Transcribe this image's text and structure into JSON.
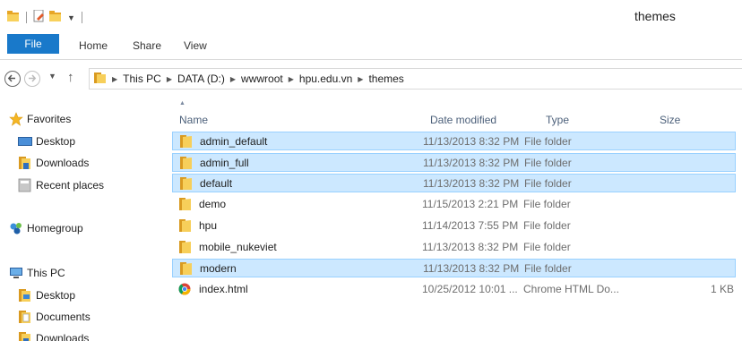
{
  "window": {
    "title": "themes"
  },
  "ribbon": {
    "tabs": [
      "File",
      "Home",
      "Share",
      "View"
    ]
  },
  "address": {
    "crumbs": [
      "This PC",
      "DATA (D:)",
      "wwwroot",
      "hpu.edu.vn",
      "themes"
    ]
  },
  "navpane": {
    "favorites": "Favorites",
    "desktop": "Desktop",
    "downloads": "Downloads",
    "recent": "Recent places",
    "homegroup": "Homegroup",
    "thispc": "This PC",
    "pc_desktop": "Desktop",
    "pc_documents": "Documents",
    "pc_downloads": "Downloads"
  },
  "columns": {
    "name": "Name",
    "date": "Date modified",
    "type": "Type",
    "size": "Size"
  },
  "files": [
    {
      "name": "admin_default",
      "date": "11/13/2013 8:32 PM",
      "type": "File folder",
      "size": "",
      "selected": true,
      "icon": "folder-icon"
    },
    {
      "name": "admin_full",
      "date": "11/13/2013 8:32 PM",
      "type": "File folder",
      "size": "",
      "selected": true,
      "icon": "folder-icon"
    },
    {
      "name": "default",
      "date": "11/13/2013 8:32 PM",
      "type": "File folder",
      "size": "",
      "selected": true,
      "icon": "folder-icon"
    },
    {
      "name": "demo",
      "date": "11/15/2013 2:21 PM",
      "type": "File folder",
      "size": "",
      "selected": false,
      "icon": "folder-icon"
    },
    {
      "name": "hpu",
      "date": "11/14/2013 7:55 PM",
      "type": "File folder",
      "size": "",
      "selected": false,
      "icon": "folder-icon"
    },
    {
      "name": "mobile_nukeviet",
      "date": "11/13/2013 8:32 PM",
      "type": "File folder",
      "size": "",
      "selected": false,
      "icon": "folder-icon"
    },
    {
      "name": "modern",
      "date": "11/13/2013 8:32 PM",
      "type": "File folder",
      "size": "",
      "selected": true,
      "icon": "folder-icon"
    },
    {
      "name": "index.html",
      "date": "10/25/2012 10:01 ...",
      "type": "Chrome HTML Do...",
      "size": "1 KB",
      "selected": false,
      "icon": "chrome-icon"
    }
  ],
  "colors": {
    "file_tab": "#1979ca",
    "selection_bg": "#cce8ff",
    "selection_border": "#99d1ff",
    "header_text": "#4c607a"
  }
}
